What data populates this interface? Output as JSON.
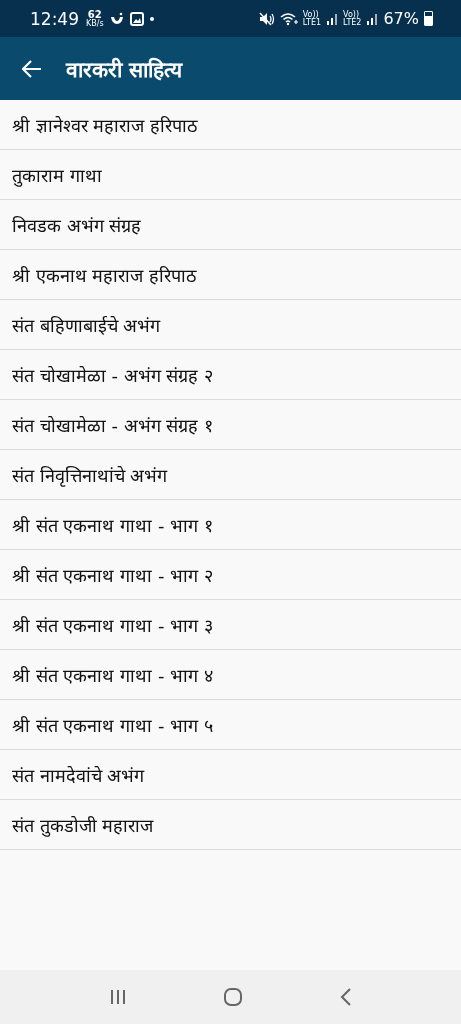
{
  "status_bar": {
    "time": "12:49",
    "speed_value": "62",
    "speed_unit": "KB/s",
    "sims": [
      {
        "top": "Vo))",
        "bottom": "LTE1"
      },
      {
        "top": "Vo))",
        "bottom": "LTE2"
      }
    ],
    "battery": "67%"
  },
  "app_bar": {
    "title": "वारकरी साहित्य"
  },
  "items": [
    {
      "label": "श्री ज्ञानेश्वर महाराज हरिपाठ"
    },
    {
      "label": "तुकाराम गाथा"
    },
    {
      "label": "निवडक अभंग संग्रह"
    },
    {
      "label": "श्री एकनाथ महाराज हरिपाठ"
    },
    {
      "label": "संत बहिणाबाईचे अभंग"
    },
    {
      "label": "संत चोखामेळा - अभंग संग्रह २"
    },
    {
      "label": "संत चोखामेळा - अभंग संग्रह १"
    },
    {
      "label": "संत निवृत्तिनाथांचे अभंग"
    },
    {
      "label": "श्री संत एकनाथ गाथा - भाग १"
    },
    {
      "label": "श्री संत एकनाथ गाथा - भाग २"
    },
    {
      "label": "श्री संत एकनाथ गाथा - भाग ३"
    },
    {
      "label": "श्री संत एकनाथ गाथा - भाग ४"
    },
    {
      "label": "श्री संत एकनाथ गाथा - भाग ५"
    },
    {
      "label": "संत नामदेवांचे अभंग"
    },
    {
      "label": "संत तुकडोजी महाराज"
    }
  ]
}
